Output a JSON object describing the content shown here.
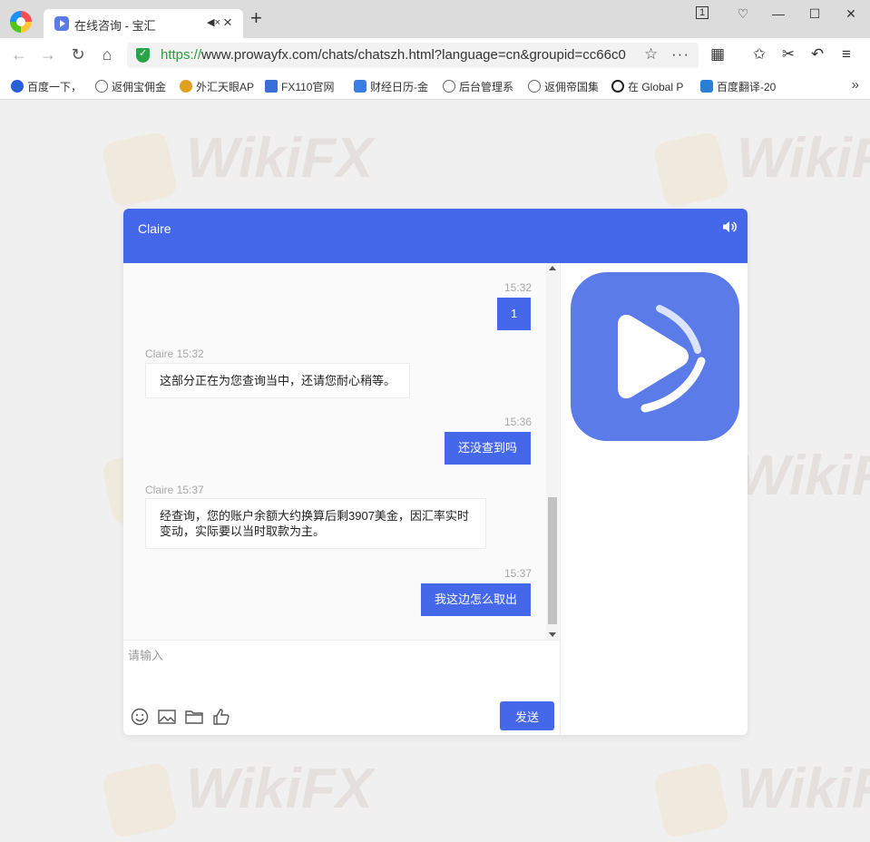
{
  "browser": {
    "tab_title": "在线咨询 - 宝汇",
    "tab_mute": "◀×",
    "tab_close": "×",
    "new_tab": "+",
    "url_scheme": "https://",
    "url_rest": "www.prowayfx.com/chats/chatszh.html?language=cn&groupid=cc66c0",
    "window_buttons": [
      "1",
      "♡",
      "—",
      "☐",
      "✕"
    ],
    "bookmarks": [
      {
        "label": "百度一下，",
        "color": "#2b5fd9"
      },
      {
        "label": "返佣宝佣金",
        "color": "#666666"
      },
      {
        "label": "外汇天眼AP",
        "color": "#e0a020"
      },
      {
        "label": "FX110官网",
        "color": "#3a6fd8"
      },
      {
        "label": "财经日历-金",
        "color": "#3b7de0"
      },
      {
        "label": "后台管理系",
        "color": "#666666"
      },
      {
        "label": "返佣帝国集",
        "color": "#666666"
      },
      {
        "label": "在 Global P",
        "color": "#222222"
      },
      {
        "label": "百度翻译-20",
        "color": "#2a7fd4"
      }
    ],
    "bookmarks_more": "»"
  },
  "watermark": "WikiFX",
  "chat": {
    "agent_name": "Claire",
    "theme_color": "#4567ea",
    "messages": [
      {
        "side": "out",
        "time": "15:32",
        "text": "1"
      },
      {
        "side": "in",
        "meta": "Claire 15:32",
        "text": "这部分正在为您查询当中，还请您耐心稍等。"
      },
      {
        "side": "out",
        "time": "15:36",
        "text": "还没查到吗"
      },
      {
        "side": "in",
        "meta": "Claire 15:37",
        "text": "经查询，您的账户余额大约换算后剩3907美金，因汇率实时变动，实际要以当时取款为主。"
      },
      {
        "side": "out",
        "time": "15:37",
        "text": "我这边怎么取出"
      }
    ],
    "input_placeholder": "请输入",
    "send_label": "发送",
    "tools": [
      "emoji-icon",
      "image-icon",
      "folder-icon",
      "thumbs-up-icon"
    ]
  }
}
